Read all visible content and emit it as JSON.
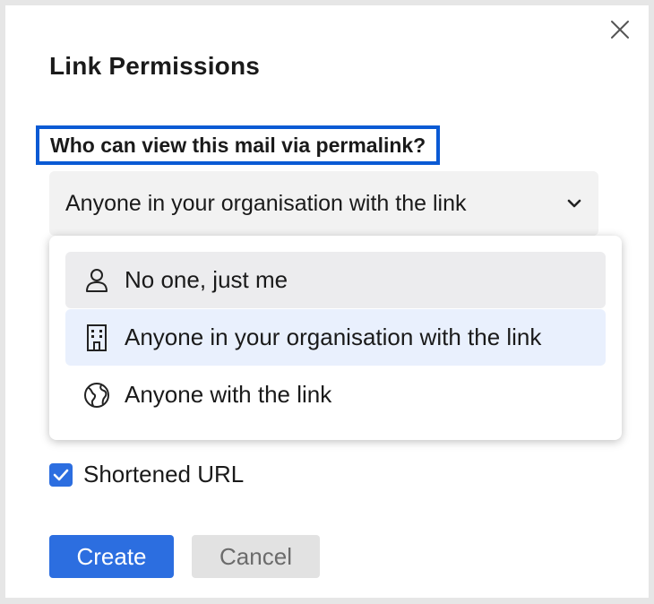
{
  "dialog": {
    "title": "Link Permissions",
    "question": "Who can view this mail via permalink?",
    "close_icon": "close-icon"
  },
  "select": {
    "value": "Anyone in your organisation with the link",
    "icon": "chevron-down-icon"
  },
  "options": [
    {
      "label": "No one, just me",
      "icon": "user-icon",
      "state": "hover"
    },
    {
      "label": "Anyone in your organisation with the link",
      "icon": "building-icon",
      "state": "selected"
    },
    {
      "label": "Anyone with the link",
      "icon": "globe-icon",
      "state": "none"
    }
  ],
  "shortened_url": {
    "label": "Shortened URL",
    "checked": true
  },
  "buttons": {
    "create": "Create",
    "cancel": "Cancel"
  },
  "colors": {
    "focus_border": "#0a5ad4",
    "primary": "#2c6ee0",
    "selected_bg": "#e9f0fd",
    "hover_bg": "#ececee"
  }
}
